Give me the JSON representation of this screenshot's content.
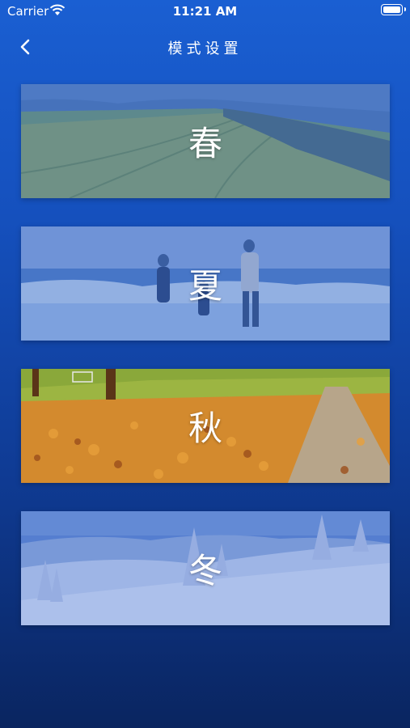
{
  "status_bar": {
    "carrier": "Carrier",
    "time": "11:21 AM"
  },
  "nav": {
    "title": "模式设置",
    "back_icon": "chevron-left-icon"
  },
  "seasons": [
    {
      "label": "春"
    },
    {
      "label": "夏"
    },
    {
      "label": "秋"
    },
    {
      "label": "冬"
    }
  ],
  "colors": {
    "background_top": "#1a5fd2",
    "background_bottom": "#0a2560"
  }
}
